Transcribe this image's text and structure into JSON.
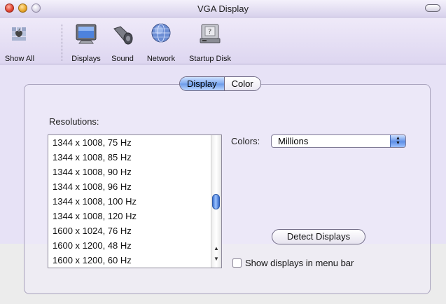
{
  "window": {
    "title": "VGA Display"
  },
  "toolbar": {
    "items": [
      {
        "label": "Show All",
        "icon": "apple-logo-icon"
      },
      {
        "label": "Displays",
        "icon": "display-monitor-icon"
      },
      {
        "label": "Sound",
        "icon": "speaker-icon"
      },
      {
        "label": "Network",
        "icon": "network-globe-icon"
      },
      {
        "label": "Startup Disk",
        "icon": "startup-disk-icon"
      }
    ]
  },
  "tabs": [
    {
      "label": "Display",
      "selected": true
    },
    {
      "label": "Color",
      "selected": false
    }
  ],
  "resolutions": {
    "label": "Resolutions:",
    "items": [
      "1344 x 1008, 75 Hz",
      "1344 x 1008, 85 Hz",
      "1344 x 1008, 90 Hz",
      "1344 x 1008, 96 Hz",
      "1344 x 1008, 100 Hz",
      "1344 x 1008, 120 Hz",
      "1600 x 1024, 76 Hz",
      "1600 x 1200, 48 Hz",
      "1600 x 1200, 60 Hz"
    ]
  },
  "colors": {
    "label": "Colors:",
    "value": "Millions"
  },
  "buttons": {
    "detect": "Detect Displays"
  },
  "checkbox": {
    "label": "Show displays in menu bar",
    "checked": false
  },
  "accent": "#6a9ae8"
}
